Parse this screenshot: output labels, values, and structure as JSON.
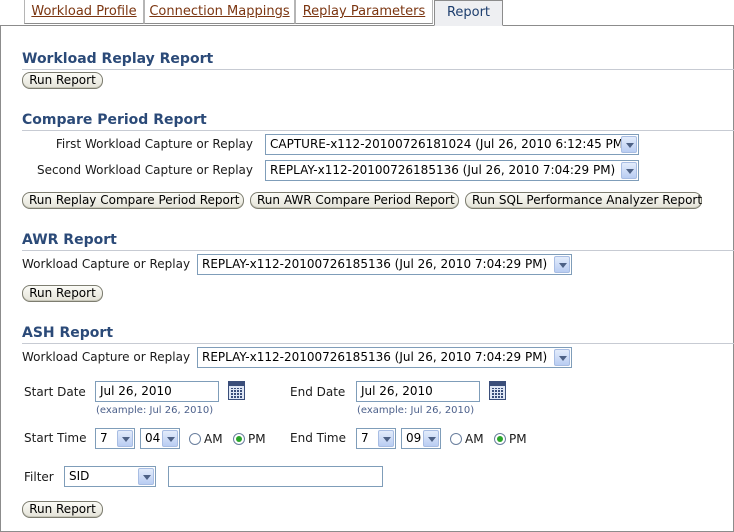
{
  "tabs": [
    {
      "label": "Workload Profile"
    },
    {
      "label": "Connection Mappings"
    },
    {
      "label": "Replay Parameters"
    },
    {
      "label": "Report"
    }
  ],
  "workload_replay": {
    "title": "Workload Replay Report",
    "run_label": "Run Report"
  },
  "compare_period": {
    "title": "Compare Period Report",
    "first_label": "First Workload Capture or Replay",
    "first_value": "CAPTURE-x112-20100726181024 (Jul 26, 2010 6:12:45 PM)",
    "second_label": "Second Workload Capture or Replay",
    "second_value": "REPLAY-x112-20100726185136 (Jul 26, 2010 7:04:29 PM)",
    "btn_replay": "Run Replay Compare Period Report",
    "btn_awr": "Run AWR Compare Period Report",
    "btn_spa": "Run SQL Performance Analyzer Report"
  },
  "awr": {
    "title": "AWR Report",
    "label": "Workload Capture or Replay",
    "value": "REPLAY-x112-20100726185136 (Jul 26, 2010 7:04:29 PM)",
    "run_label": "Run Report"
  },
  "ash": {
    "title": "ASH Report",
    "label": "Workload Capture or Replay",
    "value": "REPLAY-x112-20100726185136 (Jul 26, 2010 7:04:29 PM)",
    "start_date_label": "Start Date",
    "start_date_value": "Jul 26, 2010",
    "start_date_hint": "(example: Jul 26, 2010)",
    "end_date_label": "End Date",
    "end_date_value": "Jul 26, 2010",
    "end_date_hint": "(example: Jul 26, 2010)",
    "start_time_label": "Start Time",
    "start_hour": "7",
    "start_minute": "04",
    "end_time_label": "End Time",
    "end_hour": "7",
    "end_minute": "09",
    "am_label": "AM",
    "pm_label": "PM",
    "start_ampm_selected": "PM",
    "end_ampm_selected": "PM",
    "filter_label": "Filter",
    "filter_type": "SID",
    "filter_value": "",
    "run_label": "Run Report"
  },
  "colors": {
    "section_title": "#2b4a78",
    "tab_link": "#7b3510",
    "radio_selected": "#2aa52a"
  },
  "icons": [
    "calendar-icon",
    "chevron-down-icon"
  ]
}
